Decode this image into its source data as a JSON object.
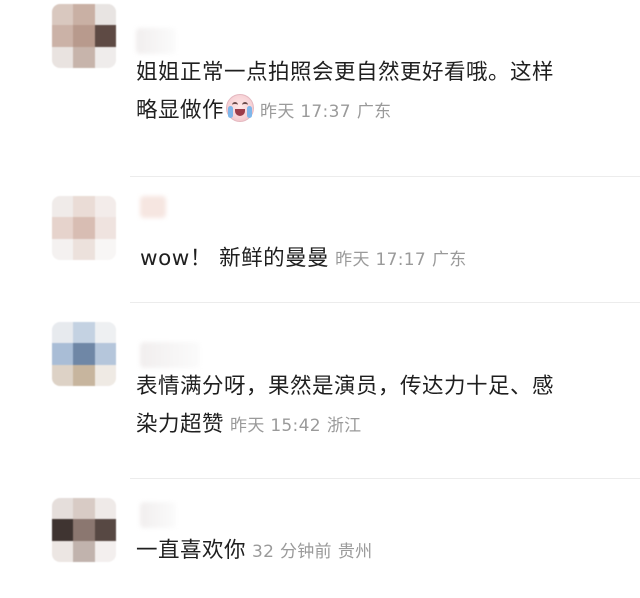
{
  "comments": [
    {
      "lines": [
        "姐姐正常一点拍照会更自然更好看哦。这样",
        "略显做作"
      ],
      "emoji": "crying-face-icon",
      "time": "昨天 17:37",
      "location": "广东"
    },
    {
      "lines": [
        "wow！ 新鲜的曼曼"
      ],
      "time": "昨天 17:17",
      "location": "广东"
    },
    {
      "lines": [
        "表情满分呀，果然是演员，传达力十足、感",
        "染力超赞"
      ],
      "time": "昨天 15:42",
      "location": "浙江"
    },
    {
      "lines": [
        "一直喜欢你"
      ],
      "time": "32 分钟前",
      "location": "贵州"
    }
  ]
}
